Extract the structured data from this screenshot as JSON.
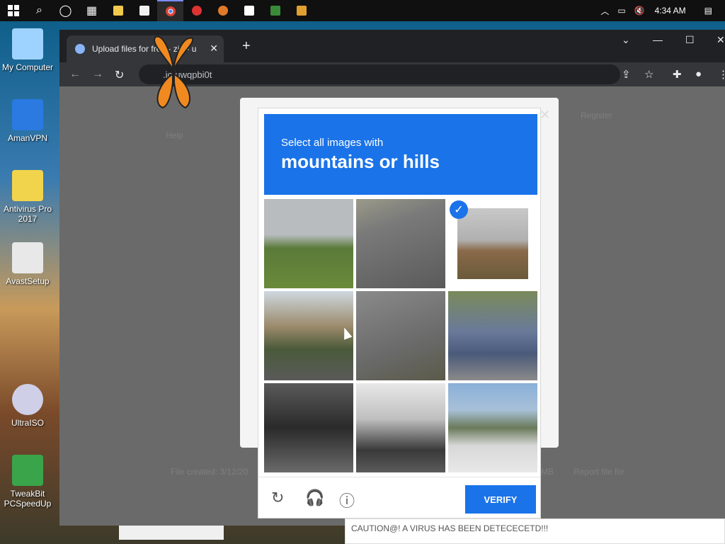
{
  "taskbar": {
    "apps": [
      "windows-start",
      "search",
      "cortana",
      "task-view",
      "file-explorer",
      "store",
      "chrome",
      "app-red",
      "app-orange",
      "app-7z",
      "app-grid",
      "app-image"
    ],
    "time": "4:34 AM"
  },
  "desktop": {
    "icons": [
      {
        "label": "My Computer"
      },
      {
        "label": "AmanVPN"
      },
      {
        "label": "Antivirus Pro 2017"
      },
      {
        "label": "AvastSetup"
      },
      {
        "label": "UltraISO"
      },
      {
        "label": "TweakBit PCSpeedUp"
      }
    ]
  },
  "browser": {
    "tab_title": "Upload files for free - zip - u",
    "url": ".io/uwqpbi0t",
    "new_tab": "+"
  },
  "page": {
    "ghost_texts": [
      "Register",
      "Help",
      "File created: 3/12/20",
      "MB",
      "Report file for"
    ]
  },
  "captcha": {
    "instruction_small": "Select all images with",
    "instruction_large": "mountains or hills",
    "verify_label": "VERIFY",
    "tiles": [
      "hillside road",
      "crosswalk",
      "mountain (selected)",
      "street buildings",
      "road marking",
      "blue car",
      "motorcycles",
      "scooter",
      "mountains parking"
    ],
    "selected_tile": 2
  },
  "notification": "CAUTION@! A VIRUS HAS BEEN DETECECETD!!!"
}
